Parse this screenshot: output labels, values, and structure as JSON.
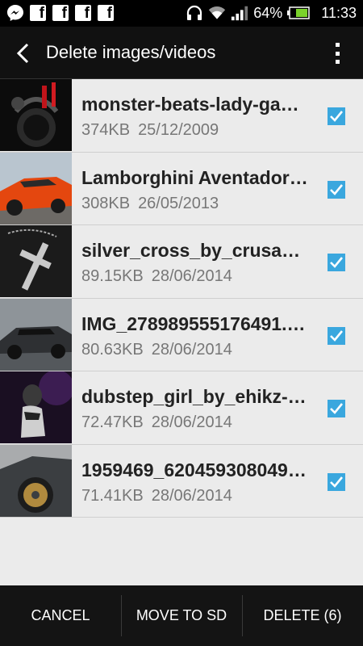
{
  "status_bar": {
    "battery_percent": "64%",
    "time": "11:33",
    "left_icons": [
      "messenger-icon",
      "facebook-icon",
      "facebook-icon",
      "facebook-icon",
      "facebook-icon"
    ],
    "right_icons": [
      "headphones-icon",
      "wifi-icon",
      "signal-icon",
      "battery-icon"
    ]
  },
  "action_bar": {
    "title": "Delete images/videos"
  },
  "items": [
    {
      "name": "monster-beats-lady-gag…",
      "size": "374KB",
      "date": "25/12/2009",
      "checked": true
    },
    {
      "name": "Lamborghini Aventador…",
      "size": "308KB",
      "date": "26/05/2013",
      "checked": true
    },
    {
      "name": "silver_cross_by_crusadie…",
      "size": "89.15KB",
      "date": "28/06/2014",
      "checked": true
    },
    {
      "name": "IMG_278989555176491.…",
      "size": "80.63KB",
      "date": "28/06/2014",
      "checked": true
    },
    {
      "name": "dubstep_girl_by_ehikz-d…",
      "size": "72.47KB",
      "date": "28/06/2014",
      "checked": true
    },
    {
      "name": "1959469_620459308049…",
      "size": "71.41KB",
      "date": "28/06/2014",
      "checked": true
    }
  ],
  "bottom_bar": {
    "cancel": "CANCEL",
    "move": "MOVE TO SD",
    "delete": "DELETE (6)"
  },
  "colors": {
    "accent": "#3aa7de",
    "background": "#ebebeb",
    "bars": "#111111"
  }
}
